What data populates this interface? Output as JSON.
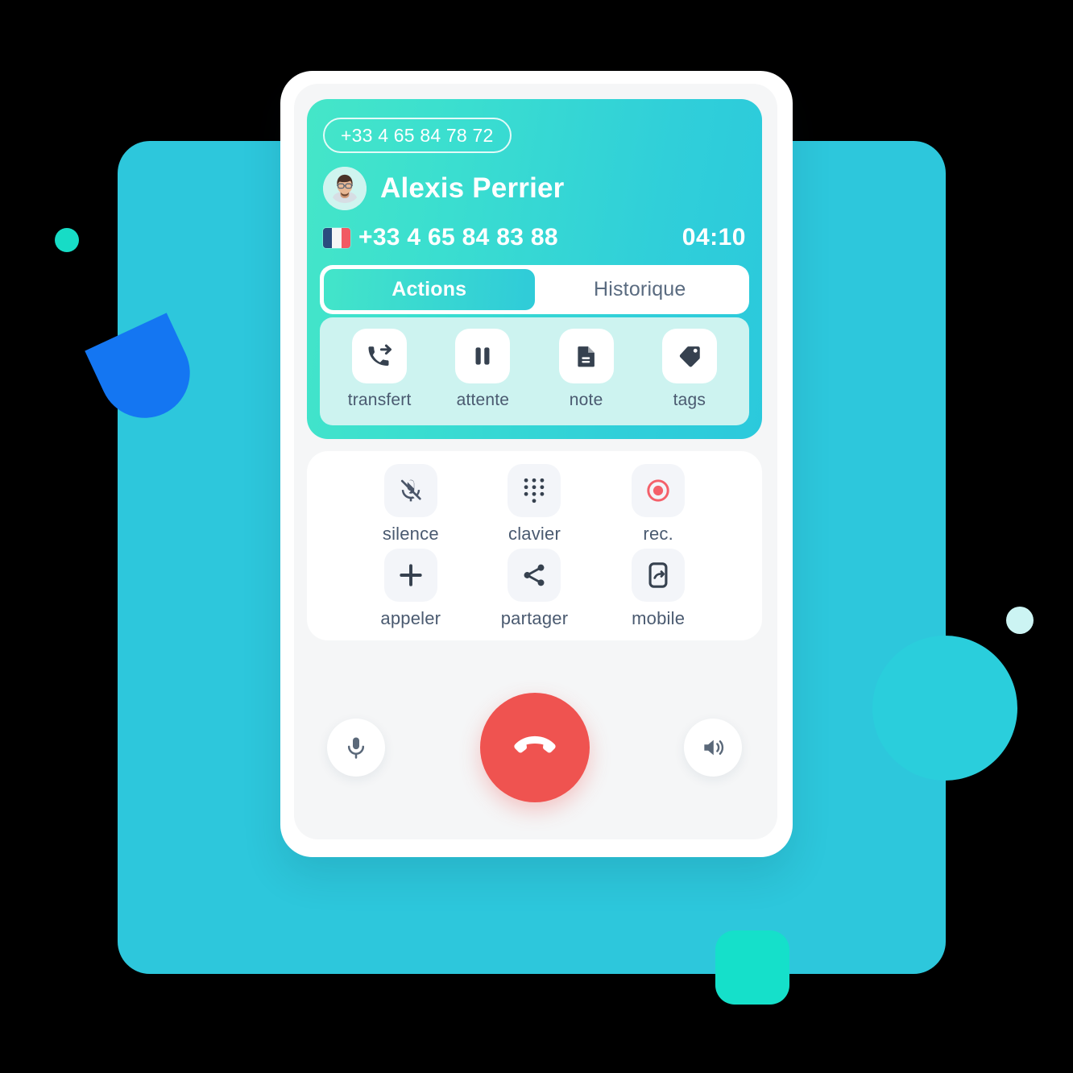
{
  "background": {
    "panel_color": "#2DC7DC",
    "circle_color": "#2ACEDC",
    "teal_dot_color": "#17DCC6",
    "pale_dot_color": "#CCF4F3",
    "half_disc_color": "#1476F2",
    "square_color": "#15E0CA"
  },
  "header": {
    "caller_id": "+33 4 65 84 78 72",
    "contact_name": "Alexis Perrier",
    "phone_number": "+33 4 65 84 83 88",
    "call_timer": "04:10",
    "flag": "france-flag",
    "avatar": "contact-avatar",
    "gradient_from": "#45E6C8",
    "gradient_to": "#2BC9DC"
  },
  "tabs": [
    {
      "label": "Actions",
      "active": true
    },
    {
      "label": "Historique",
      "active": false
    }
  ],
  "actions": [
    {
      "label": "transfert",
      "icon": "call-transfer-icon"
    },
    {
      "label": "attente",
      "icon": "pause-icon"
    },
    {
      "label": "note",
      "icon": "document-note-icon"
    },
    {
      "label": "tags",
      "icon": "tag-icon"
    }
  ],
  "controls": [
    {
      "label": "silence",
      "icon": "microphone-muted-icon"
    },
    {
      "label": "clavier",
      "icon": "dialpad-icon"
    },
    {
      "label": "rec.",
      "icon": "record-icon",
      "color": "#F4606A"
    },
    {
      "label": "appeler",
      "icon": "plus-icon"
    },
    {
      "label": "partager",
      "icon": "share-icon"
    },
    {
      "label": "mobile",
      "icon": "mobile-transfer-icon"
    }
  ],
  "bottom_bar": {
    "mic_icon": "microphone-icon",
    "hangup_icon": "hangup-phone-icon",
    "hangup_color": "#EF5350",
    "speaker_icon": "speaker-icon"
  }
}
